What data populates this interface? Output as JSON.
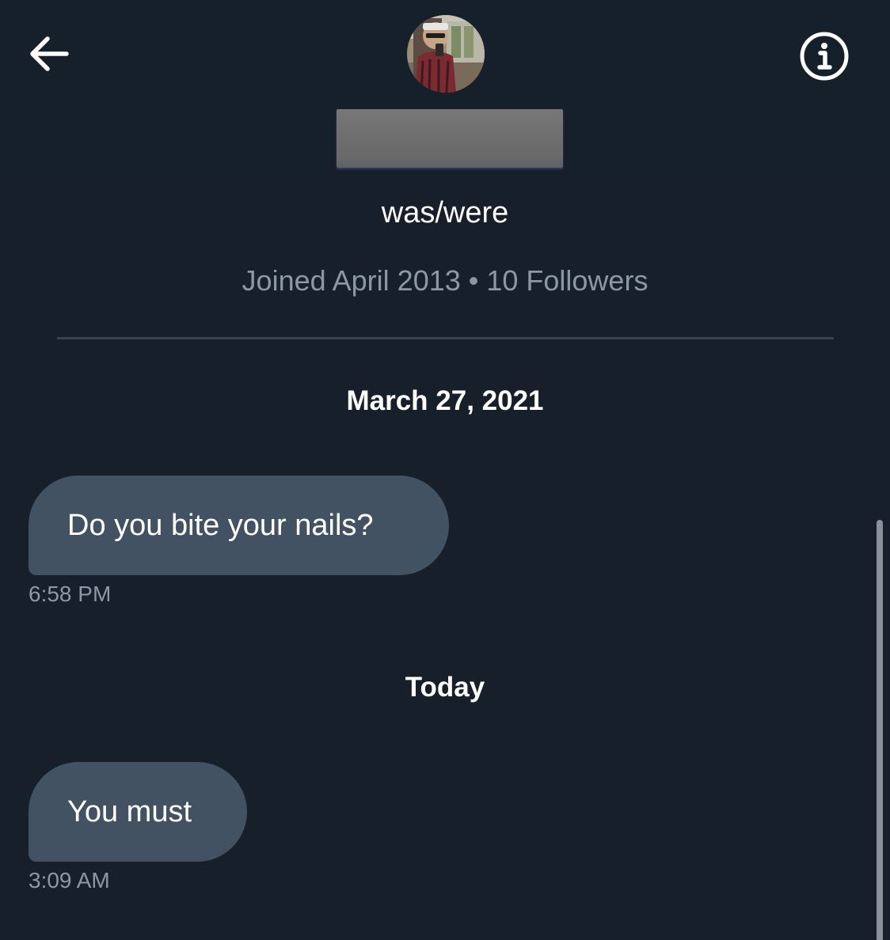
{
  "header": {
    "back_icon": "arrow-left-icon",
    "info_icon": "info-icon",
    "avatar_alt": "profile photo"
  },
  "profile": {
    "pronouns": "was/were",
    "joined_text": "Joined April 2013 • 10 Followers"
  },
  "conversation": {
    "sections": [
      {
        "date_label": "March 27, 2021",
        "message": "Do you bite your nails?",
        "time": "6:58 PM"
      },
      {
        "date_label": "Today",
        "message": "You must",
        "time": "3:09 AM"
      }
    ]
  },
  "colors": {
    "background": "#17202a",
    "bubble": "#425262",
    "secondary_text": "#8b98a5",
    "divider": "#38444d"
  }
}
